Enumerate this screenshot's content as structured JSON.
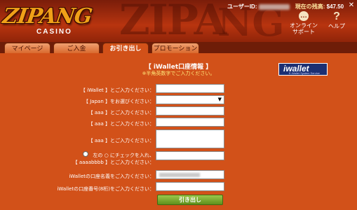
{
  "header": {
    "logo_main": "ZIPANG",
    "logo_sub": "CASINO",
    "user_id_label": "ユーザーID:",
    "balance_label": "現在の残高:",
    "balance": "$47.50",
    "close_glyph": "✕",
    "support_label_1": "オンライン",
    "support_label_2": "サポート",
    "help_label": "ヘルプ",
    "support_icon": "chat-icon",
    "help_icon": "question-icon"
  },
  "tabs": [
    {
      "label": "マイページ"
    },
    {
      "label": "ご入金"
    },
    {
      "label": "お引き出し",
      "active": true
    },
    {
      "label": "プロモーション"
    }
  ],
  "form": {
    "title": "【 iWallet口座情報 】",
    "subtitle": "※半角英数字でご入力ください。",
    "logo_text": "iwallet",
    "logo_sub": "E-Wallet System Service",
    "fields": [
      {
        "label": "【 iWallet 】とご入力ください：",
        "value": ""
      },
      {
        "label": "【 Japan 】をお選びください：",
        "value": ""
      },
      {
        "label": "【 aaa 】とご入力ください：",
        "value": ""
      },
      {
        "label": "【 aaa 】とご入力ください：",
        "value": ""
      },
      {
        "label": "【 aaa 】とご入力ください：",
        "value": ""
      },
      {
        "label_1": "左の ○ にチェックを入れ、",
        "label_2": "【 aaaabbbb 】とご入力ください：",
        "value": ""
      },
      {
        "label": "iWalletの口座名義をご入力ください：",
        "value": ""
      },
      {
        "label": "iWalletの口座番号(8桁)をご入力ください：",
        "value": ""
      }
    ],
    "submit_label": "引き出し"
  },
  "colors": {
    "panel": "#d25119",
    "header": "#b8340f",
    "accent_yellow": "#ffe97a",
    "submit_green": "#7aa832"
  }
}
